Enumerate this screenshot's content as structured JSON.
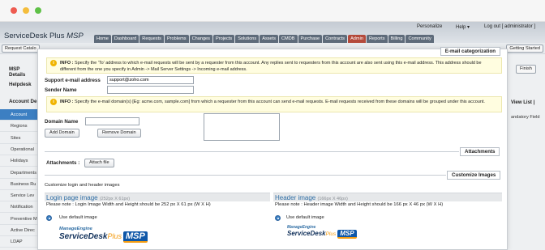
{
  "header": {
    "brand": "ServiceDesk Plus",
    "brand_suffix": "MSP",
    "top_links": {
      "personalize": "Personalize",
      "help": "Help ▾",
      "logout": "Log out [ administrator ]"
    },
    "nav_tabs": [
      "Home",
      "Dashboard",
      "Requests",
      "Problems",
      "Changes",
      "Projects",
      "Solutions",
      "Assets",
      "CMDB",
      "Purchase",
      "Contracts",
      "Admin",
      "Reports",
      "Billing",
      "Community"
    ],
    "active_tab": "Admin"
  },
  "subbar": {
    "request_catalog": "Request Catalo",
    "getting_started": "Getting Started"
  },
  "sidebar": {
    "msp_details": "MSP Details",
    "helpdesk": "Helpdesk",
    "account_details": "Account De",
    "items": [
      "Account",
      "Regions",
      "Sites",
      "Operational",
      "Holidays",
      "Departments",
      "Business Ru",
      "Service Lev",
      "Notification",
      "Preventive M",
      "Active Direc",
      "LDAP"
    ]
  },
  "right_bg": {
    "finish": "Finish",
    "view_list": "View List |",
    "mandatory": "andatory Field"
  },
  "panel": {
    "email_section": "E-mail categorization",
    "info1_label": "INFO :",
    "info1_text": "Specify the 'To' address to which e-mail requests will be sent by a requester from this account. Any replies sent to requesters from this account are also sent using this e-mail address. This address should be different from the one you specify in Admin -> Mail Server Settings -> Incoming e-mail address.",
    "support_email_label": "Support e-mail address",
    "support_email_value": "support@zoho.com",
    "sender_name_label": "Sender Name",
    "sender_name_value": "",
    "info2_label": "INFO :",
    "info2_text": "Specify the e-mail domain(s) [Eg: acme.com, sample.com] from which a requester from this account can send e-mail requests. E-mail requests received from these domains will be grouped under this account.",
    "domain_name_label": "Domain Name",
    "domain_name_value": "",
    "add_domain": "Add Domain",
    "remove_domain": "Remove Domain",
    "attachments_section": "Attachments",
    "attachments_label": "Attachments :",
    "attach_file": "Attach file",
    "customize_section": "Customize Images",
    "customize_desc": "Customize login and header images",
    "login_image_title": "Login page image",
    "login_image_dim": "(252px X 61px)",
    "login_image_note": "Please note : Login Image Width and Height should be 252 px X 61 px (W X H)",
    "header_image_title": "Header image",
    "header_image_dim": "(166px X 46px)",
    "header_image_note": "Please note : Header image Width and Height should be 166 px X 46 px (W X H)",
    "use_default_1": "Use default image",
    "use_default_2": "Use default image",
    "logo_manage_engine": "ManageEngine",
    "logo_servicedesk": "ServiceDesk",
    "logo_plus": "Plus",
    "logo_msp": "MSP"
  },
  "colors": {
    "nav_tab": "#5e6b7a",
    "nav_tab_active": "#b44a3b",
    "sidebar_active": "#3c7fc2",
    "info_bg": "#fffde0",
    "section_title": "#2e6da4"
  }
}
